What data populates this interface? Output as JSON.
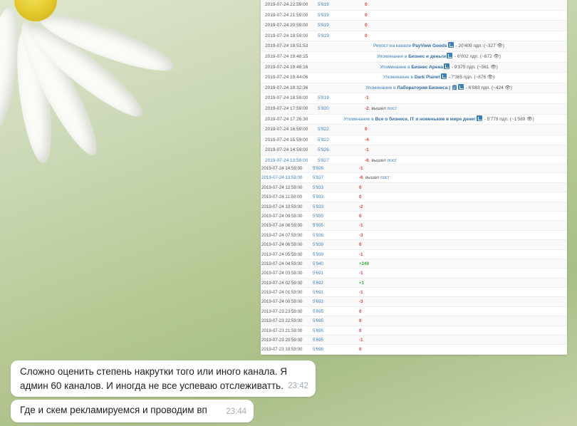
{
  "stats_top": [
    {
      "time": "2019-07-24 22:59:00",
      "subs": "5'919",
      "delta": "0"
    },
    {
      "time": "2019-07-24 21:59:00",
      "subs": "5'919",
      "delta": "0"
    },
    {
      "time": "2019-07-24 20:59:00",
      "subs": "5'919",
      "delta": "0"
    },
    {
      "time": "2019-07-24 19:59:00",
      "subs": "5'919",
      "delta": "0"
    },
    {
      "time": "2019-07-24 19:51:53",
      "mention": {
        "prefix": "Репост на канале ",
        "channel": "PayView Goods",
        "suffix": " - 20'409 пдп. (~327 👁)"
      }
    },
    {
      "time": "2019-07-24 19:48:15",
      "mention": {
        "prefix": "Упоминание в ",
        "channel": "Бизнес и деньги",
        "suffix": " - 6'002 пдп. (~872 👁)"
      }
    },
    {
      "time": "2019-07-24 19:46:16",
      "mention": {
        "prefix": "Упоминание в ",
        "channel": "Бизнес Арена",
        "suffix": " - 9'375 пдп. (~561 👁)"
      }
    },
    {
      "time": "2019-07-24 19:44:06",
      "mention": {
        "prefix": "Упоминание в ",
        "channel": "Dark Planet",
        "suffix": " - 7'365 пдп. (~876 👁)"
      }
    },
    {
      "time": "2019-07-24 19:32:36",
      "mention": {
        "prefix": "Упоминание в ",
        "channel": "Лаборатория Бизнеса | 🗒",
        "suffix": " - 6'083 пдп. (~424 👁)"
      }
    },
    {
      "time": "2019-07-24 18:59:00",
      "subs": "5'919",
      "delta": "-1"
    },
    {
      "time": "2019-07-24 17:59:00",
      "subs": "5'920",
      "delta": "-2",
      "note": ", вышел ",
      "note_link": "пост"
    },
    {
      "time": "2019-07-24 17:26:30",
      "mention": {
        "prefix": "Упоминание в ",
        "channel": "Все о бизнесе, IT и новеньком в мире денег",
        "suffix": " - 5'779 пдп. (~1'589 👁)"
      }
    },
    {
      "time": "2019-07-24 16:59:00",
      "subs": "5'922",
      "delta": "0"
    },
    {
      "time": "2019-07-24 15:59:00",
      "subs": "5'922",
      "delta": "-4"
    },
    {
      "time": "2019-07-24 14:59:00",
      "subs": "5'926",
      "delta": "-1"
    },
    {
      "time": "2019-07-24 13:59:00",
      "subs": "5'927",
      "delta": "-6",
      "note": ", вышел ",
      "note_link": "пост",
      "time_link": true
    }
  ],
  "stats_bottom": [
    {
      "time": "2019-07-24 14:59:00",
      "subs": "5'926",
      "delta": "-1"
    },
    {
      "time": "2019-07-24 13:59:00",
      "subs": "5'927",
      "delta": "-6",
      "note": ", вышел ",
      "note_link": "пост",
      "time_link": true
    },
    {
      "time": "2019-07-24 12:59:00",
      "subs": "5'933",
      "delta": "0"
    },
    {
      "time": "2019-07-24 11:59:00",
      "subs": "5'933",
      "delta": "0"
    },
    {
      "time": "2019-07-24 10:59:00",
      "subs": "5'933",
      "delta": "-2"
    },
    {
      "time": "2019-07-24 09:59:00",
      "subs": "5'935",
      "delta": "0"
    },
    {
      "time": "2019-07-24 08:59:00",
      "subs": "5'935",
      "delta": "-1"
    },
    {
      "time": "2019-07-24 07:59:00",
      "subs": "5'936",
      "delta": "-3"
    },
    {
      "time": "2019-07-24 06:59:00",
      "subs": "5'939",
      "delta": "0"
    },
    {
      "time": "2019-07-24 05:59:00",
      "subs": "5'939",
      "delta": "-1"
    },
    {
      "time": "2019-07-24 04:59:00",
      "subs": "5'940",
      "delta": "+249"
    },
    {
      "time": "2019-07-24 03:59:00",
      "subs": "5'691",
      "delta": "-1"
    },
    {
      "time": "2019-07-24 02:59:00",
      "subs": "5'692",
      "delta": "+1"
    },
    {
      "time": "2019-07-24 01:59:00",
      "subs": "5'691",
      "delta": "-1"
    },
    {
      "time": "2019-07-24 00:59:00",
      "subs": "5'692",
      "delta": "-3"
    },
    {
      "time": "2019-07-23 23:59:00",
      "subs": "5'695",
      "delta": "0"
    },
    {
      "time": "2019-07-23 22:59:00",
      "subs": "5'695",
      "delta": "0"
    },
    {
      "time": "2019-07-23 21:59:00",
      "subs": "5'695",
      "delta": "0"
    },
    {
      "time": "2019-07-23 20:59:00",
      "subs": "5'695",
      "delta": "-1"
    },
    {
      "time": "2019-07-23 19:59:00",
      "subs": "5'696",
      "delta": "0"
    }
  ],
  "messages": [
    {
      "text": "Сложно оценить степень накрутки того или иного канала. Я админ 60 каналов. И иногда не все успеваю отслеживатть.",
      "time": "23:42"
    },
    {
      "text": "Где и скем рекламируемся и проводим вп",
      "time": "23:44"
    }
  ],
  "colors": {
    "link": "#3a7fc0",
    "negative": "#e23c3c",
    "positive": "#39a939"
  }
}
